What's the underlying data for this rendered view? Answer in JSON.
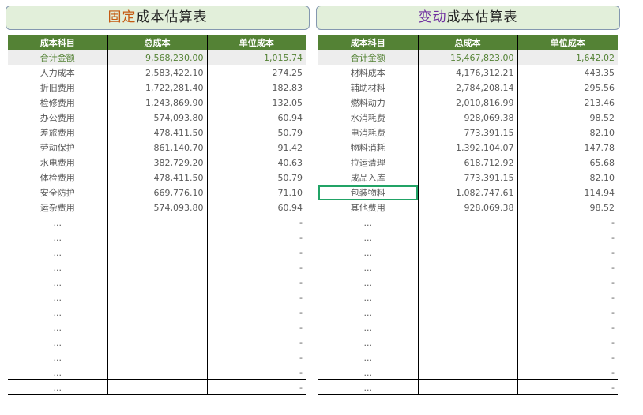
{
  "fixed": {
    "title_accent": "固定",
    "title_rest": "成本估算表",
    "headers": [
      "成本科目",
      "总成本",
      "单位成本"
    ],
    "total": [
      "合计金额",
      "9,568,230.00",
      "1,015.74"
    ],
    "rows": [
      [
        "人力成本",
        "2,583,422.10",
        "274.25"
      ],
      [
        "折旧费用",
        "1,722,281.40",
        "182.83"
      ],
      [
        "检修费用",
        "1,243,869.90",
        "132.05"
      ],
      [
        "办公费用",
        "574,093.80",
        "60.94"
      ],
      [
        "差旅费用",
        "478,411.50",
        "50.79"
      ],
      [
        "劳动保护",
        "861,140.70",
        "91.42"
      ],
      [
        "水电费用",
        "382,729.20",
        "40.63"
      ],
      [
        "体检费用",
        "478,411.50",
        "50.79"
      ],
      [
        "安全防护",
        "669,776.10",
        "71.10"
      ],
      [
        "运杂费用",
        "574,093.80",
        "60.94"
      ]
    ]
  },
  "variable": {
    "title_accent": "变动",
    "title_rest": "成本估算表",
    "headers": [
      "成本科目",
      "总成本",
      "单位成本"
    ],
    "total": [
      "合计金额",
      "15,467,823.00",
      "1,642.02"
    ],
    "rows": [
      [
        "材料成本",
        "4,176,312.21",
        "443.35"
      ],
      [
        "辅助材料",
        "2,784,208.14",
        "295.56"
      ],
      [
        "燃料动力",
        "2,010,816.99",
        "213.46"
      ],
      [
        "水消耗费",
        "928,069.38",
        "98.52"
      ],
      [
        "电消耗费",
        "773,391.15",
        "82.10"
      ],
      [
        "物料消耗",
        "1,392,104.07",
        "147.78"
      ],
      [
        "拉运清理",
        "618,712.92",
        "65.68"
      ],
      [
        "成品入库",
        "773,391.15",
        "82.10"
      ],
      [
        "包装物料",
        "1,082,747.61",
        "114.94"
      ],
      [
        "其他费用",
        "928,069.38",
        "98.52"
      ]
    ]
  },
  "empty_row": {
    "item": "...",
    "unit": "-"
  },
  "colors": {
    "header": "#548235",
    "title_bg": "#e2efda",
    "selection": "#21a366"
  }
}
